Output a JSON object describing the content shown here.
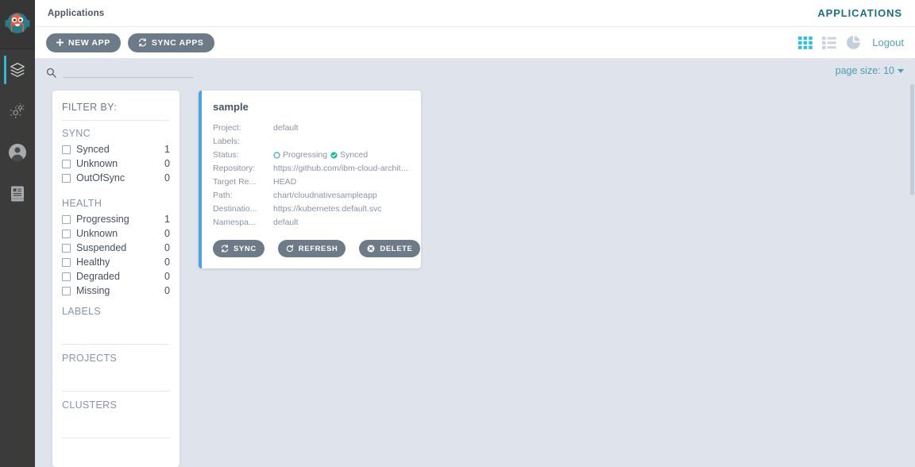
{
  "sidebar": {
    "logo_name": "argo-octopus-logo",
    "items": [
      {
        "name": "applications",
        "icon": "layers-icon",
        "active": true
      },
      {
        "name": "settings",
        "icon": "gears-icon",
        "active": false
      },
      {
        "name": "user-info",
        "icon": "user-icon",
        "active": false
      },
      {
        "name": "documentation",
        "icon": "book-icon",
        "active": false
      }
    ]
  },
  "topbar": {
    "breadcrumb": "Applications",
    "title": "APPLICATIONS"
  },
  "toolbar": {
    "new_app_label": "NEW APP",
    "sync_apps_label": "SYNC APPS",
    "logout_label": "Logout",
    "views": [
      {
        "name": "tiles-view",
        "icon": "grid-icon",
        "active": true
      },
      {
        "name": "list-view",
        "icon": "list-icon",
        "active": false
      },
      {
        "name": "summary-view",
        "icon": "pie-chart-icon",
        "active": false
      }
    ]
  },
  "search": {
    "placeholder": "",
    "value": "",
    "icon": "search-icon"
  },
  "page_size": {
    "label": "page size: 10"
  },
  "filters": {
    "title": "FILTER BY:",
    "groups": [
      {
        "title": "SYNC",
        "rows": [
          {
            "label": "Synced",
            "count": "1"
          },
          {
            "label": "Unknown",
            "count": "0"
          },
          {
            "label": "OutOfSync",
            "count": "0"
          }
        ]
      },
      {
        "title": "HEALTH",
        "rows": [
          {
            "label": "Progressing",
            "count": "1"
          },
          {
            "label": "Unknown",
            "count": "0"
          },
          {
            "label": "Suspended",
            "count": "0"
          },
          {
            "label": "Healthy",
            "count": "0"
          },
          {
            "label": "Degraded",
            "count": "0"
          },
          {
            "label": "Missing",
            "count": "0"
          }
        ]
      }
    ],
    "sections": [
      {
        "title": "LABELS"
      },
      {
        "title": "PROJECTS"
      },
      {
        "title": "CLUSTERS"
      }
    ]
  },
  "application": {
    "name": "sample",
    "fields": [
      {
        "label": "Project:",
        "value": "default"
      },
      {
        "label": "Labels:",
        "value": ""
      }
    ],
    "status_label": "Status:",
    "status": {
      "health": "Progressing",
      "sync": "Synced"
    },
    "fields2": [
      {
        "label": "Repository:",
        "value": "https://github.com/ibm-cloud-architecture/c..."
      },
      {
        "label": "Target Re...",
        "value": "HEAD"
      },
      {
        "label": "Path:",
        "value": "chart/cloudnativesampleapp"
      },
      {
        "label": "Destinatio...",
        "value": "https://kubernetes.default.svc"
      },
      {
        "label": "Namespa...",
        "value": "default"
      }
    ],
    "actions": [
      {
        "label": "SYNC",
        "icon": "sync-icon"
      },
      {
        "label": "REFRESH",
        "icon": "refresh-icon"
      },
      {
        "label": "DELETE",
        "icon": "delete-icon"
      }
    ]
  },
  "colors": {
    "accent": "#4da2dd",
    "active_nav": "#2fb9d6",
    "teal_link": "#53a3b8",
    "button_bg": "#6d7b88",
    "healthy_green": "#18be94",
    "progressing_blue": "#2fa3e0",
    "page_bg": "#dfe4ec",
    "sidebar_bg": "#3b3b3b"
  }
}
